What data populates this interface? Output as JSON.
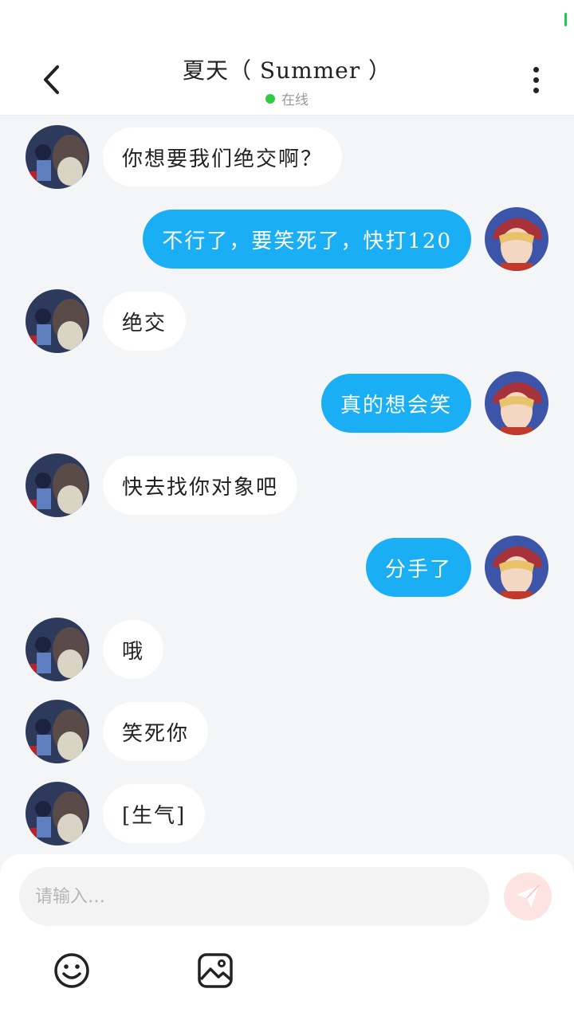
{
  "header": {
    "title": "夏天（ Summer ）",
    "status": "在线",
    "status_color": "#2ecc40"
  },
  "icons": {
    "back": "chevron-left-icon",
    "more": "more-vertical-icon",
    "send": "paper-plane-icon",
    "emoji": "smile-icon",
    "image": "image-icon"
  },
  "colors": {
    "outgoing_bubble": "#1aaff5",
    "incoming_bubble": "#ffffff",
    "background": "#f4f5f7",
    "send_button": "#fde4e3"
  },
  "messages": [
    {
      "from": "contact",
      "text": "你想要我们绝交啊？"
    },
    {
      "from": "me",
      "text": "不行了，要笑死了，快打120"
    },
    {
      "from": "contact",
      "text": "绝交"
    },
    {
      "from": "me",
      "text": "真的想会笑"
    },
    {
      "from": "contact",
      "text": "快去找你对象吧"
    },
    {
      "from": "me",
      "text": "分手了"
    },
    {
      "from": "contact",
      "text": "哦"
    },
    {
      "from": "contact",
      "text": "笑死你"
    },
    {
      "from": "contact",
      "text": "[生气]"
    }
  ],
  "composer": {
    "placeholder": "请输入…"
  }
}
